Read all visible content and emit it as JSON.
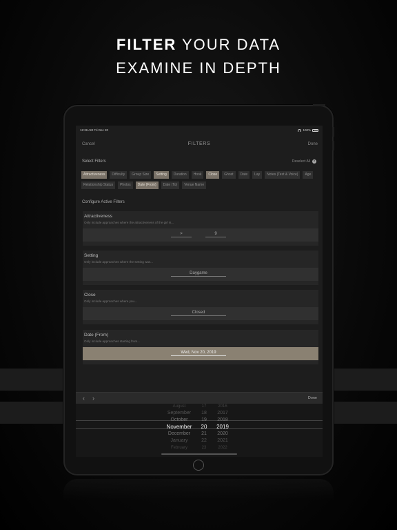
{
  "headline": {
    "line1_bold": "FILTER",
    "line1_rest": " YOUR DATA",
    "line2": "EXAMINE IN DEPTH"
  },
  "status": {
    "time": "12:36 AM   Fri Dec 20",
    "battery": "100%"
  },
  "nav": {
    "cancel": "Cancel",
    "title": "FILTERS",
    "done": "Done"
  },
  "select_filters": {
    "label": "Select Filters",
    "deselect_all": "Deselect All"
  },
  "chips_row1": [
    {
      "label": "Attractiveness",
      "active": true
    },
    {
      "label": "Difficulty",
      "active": false
    },
    {
      "label": "Group Size",
      "active": false
    },
    {
      "label": "Setting",
      "active": true
    },
    {
      "label": "Duration",
      "active": false
    },
    {
      "label": "Hook",
      "active": false
    },
    {
      "label": "Close",
      "active": true
    },
    {
      "label": "Ghost",
      "active": false
    },
    {
      "label": "Date",
      "active": false
    },
    {
      "label": "Lay",
      "active": false
    },
    {
      "label": "Notes (Text & Voice)",
      "active": false
    },
    {
      "label": "Age",
      "active": false
    }
  ],
  "chips_row2": [
    {
      "label": "Relationship Status",
      "active": false
    },
    {
      "label": "Photos",
      "active": false
    },
    {
      "label": "Date (From)",
      "active": true
    },
    {
      "label": "Date (To)",
      "active": false
    },
    {
      "label": "Venue Name",
      "active": false
    }
  ],
  "configure_label": "Configure Active Filters",
  "cards": {
    "attractiveness": {
      "title": "Attractiveness",
      "desc": "Only include approaches where the attractiveness of the girl is...",
      "operator": ">",
      "value": "9"
    },
    "setting": {
      "title": "Setting",
      "desc": "Only include approaches where the setting was...",
      "value": "Daygame"
    },
    "close": {
      "title": "Close",
      "desc": "Only include approaches where you...",
      "value": "Closed"
    },
    "date_from": {
      "title": "Date (From)",
      "desc": "Only include approaches starting from...",
      "value": "Wed, Nov 20, 2019"
    }
  },
  "toolbar": {
    "prev": "‹",
    "next": "›",
    "done": "Done"
  },
  "picker": {
    "months": [
      "August",
      "September",
      "October",
      "November",
      "December",
      "January",
      "February"
    ],
    "days": [
      "17",
      "18",
      "19",
      "20",
      "21",
      "22",
      "23"
    ],
    "years": [
      "2016",
      "2017",
      "2018",
      "2019",
      "2020",
      "2021",
      "2022"
    ]
  }
}
